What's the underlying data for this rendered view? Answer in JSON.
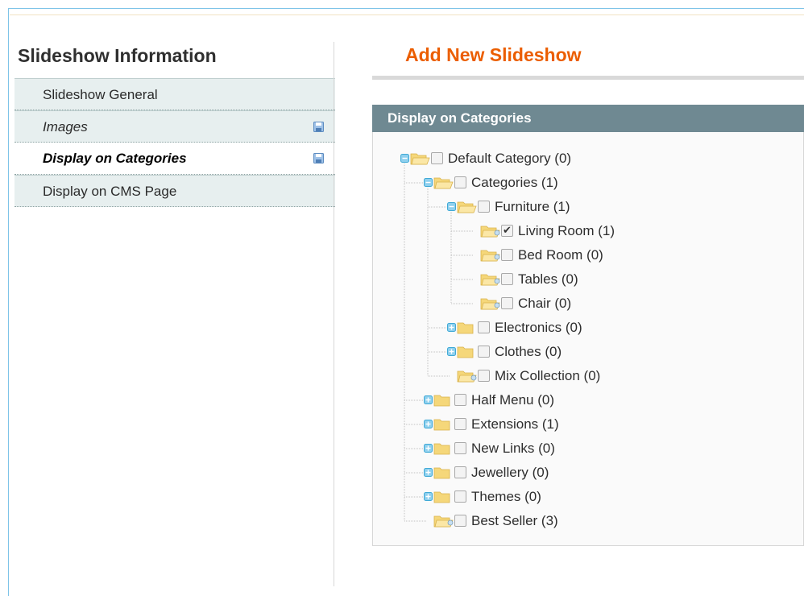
{
  "sidebar": {
    "title": "Slideshow Information",
    "items": [
      {
        "label": "Slideshow General"
      },
      {
        "label": "Images"
      },
      {
        "label": "Display on Categories"
      },
      {
        "label": "Display on CMS Page"
      }
    ]
  },
  "main": {
    "title": "Add New Slideshow",
    "panel_header": "Display on Categories"
  },
  "tree": [
    {
      "label": "Default Category (0)",
      "depth": 0,
      "toggle": "minus",
      "checked": false
    },
    {
      "label": "Categories (1)",
      "depth": 1,
      "toggle": "minus",
      "checked": false
    },
    {
      "label": "Furniture (1)",
      "depth": 2,
      "toggle": "minus",
      "checked": false
    },
    {
      "label": "Living Room (1)",
      "depth": 3,
      "toggle": "none",
      "checked": true
    },
    {
      "label": "Bed Room (0)",
      "depth": 3,
      "toggle": "none",
      "checked": false
    },
    {
      "label": "Tables (0)",
      "depth": 3,
      "toggle": "none",
      "checked": false
    },
    {
      "label": "Chair (0)",
      "depth": 3,
      "toggle": "none",
      "checked": false
    },
    {
      "label": "Electronics (0)",
      "depth": 2,
      "toggle": "plus",
      "checked": false
    },
    {
      "label": "Clothes (0)",
      "depth": 2,
      "toggle": "plus",
      "checked": false
    },
    {
      "label": "Mix Collection (0)",
      "depth": 2,
      "toggle": "none",
      "checked": false
    },
    {
      "label": "Half Menu (0)",
      "depth": 1,
      "toggle": "plus",
      "checked": false
    },
    {
      "label": "Extensions (1)",
      "depth": 1,
      "toggle": "plus",
      "checked": false
    },
    {
      "label": "New Links (0)",
      "depth": 1,
      "toggle": "plus",
      "checked": false
    },
    {
      "label": "Jewellery (0)",
      "depth": 1,
      "toggle": "plus",
      "checked": false
    },
    {
      "label": "Themes (0)",
      "depth": 1,
      "toggle": "plus",
      "checked": false
    },
    {
      "label": "Best Seller (3)",
      "depth": 1,
      "toggle": "none",
      "checked": false
    }
  ],
  "colors": {
    "accent_orange": "#eb5e00",
    "panel_header": "#6f8992",
    "nav_bg": "#e7efef",
    "toggle_blue": "#3fa9d6",
    "folder_yellow": "#f5d77a"
  },
  "icons": {
    "save": "save-icon",
    "folder": "folder-icon",
    "expand": "plus-toggle-icon",
    "collapse": "minus-toggle-icon"
  }
}
